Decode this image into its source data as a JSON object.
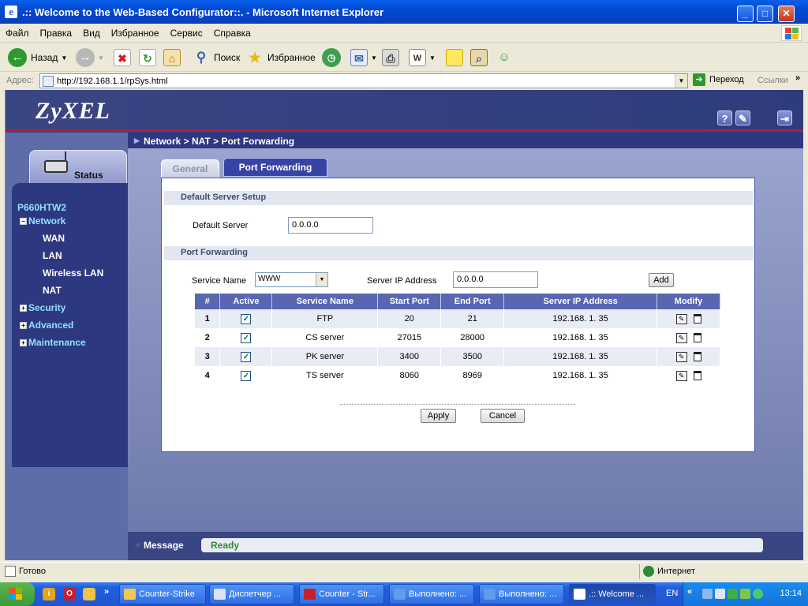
{
  "window": {
    "title": ".:: Welcome to the Web-Based Configurator::. - Microsoft Internet Explorer",
    "minimize": "_",
    "maximize": "□",
    "close": "✕"
  },
  "menubar": {
    "items": [
      "Файл",
      "Правка",
      "Вид",
      "Избранное",
      "Сервис",
      "Справка"
    ]
  },
  "toolbar": {
    "back_label": "Назад",
    "search_label": "Поиск",
    "favorites_label": "Избранное"
  },
  "addressbar": {
    "label": "Адрес:",
    "url": "http://192.168.1.1/rpSys.html",
    "go_label": "Переход",
    "links_label": "Ссылки"
  },
  "app": {
    "logo": "ZyXEL",
    "header_icons": [
      "help-icon",
      "wizard-icon",
      "logout-icon"
    ]
  },
  "breadcrumb": "Network > NAT > Port Forwarding",
  "sidebar": {
    "status_label": "Status",
    "device": "P660HTW2",
    "items": [
      {
        "label": "Network",
        "expand": "−"
      },
      {
        "label": "WAN"
      },
      {
        "label": "LAN"
      },
      {
        "label": "Wireless LAN"
      },
      {
        "label": "NAT"
      },
      {
        "label": "Security",
        "expand": "+"
      },
      {
        "label": "Advanced",
        "expand": "+"
      },
      {
        "label": "Maintenance",
        "expand": "+"
      }
    ]
  },
  "tabs": [
    {
      "label": "General"
    },
    {
      "label": "Port Forwarding"
    }
  ],
  "default_server": {
    "section_title": "Default Server Setup",
    "label": "Default Server",
    "value": "0.0.0.0"
  },
  "port_forwarding": {
    "section_title": "Port Forwarding",
    "service_name_label": "Service Name",
    "service_name_value": "WWW",
    "server_ip_label": "Server IP Address",
    "server_ip_value": "0.0.0.0",
    "add_label": "Add",
    "columns": [
      "#",
      "Active",
      "Service Name",
      "Start Port",
      "End Port",
      "Server IP Address",
      "Modify"
    ],
    "rows": [
      {
        "num": "1",
        "active": "✓",
        "name": "FTP",
        "start": "20",
        "end": "21",
        "ip": "192.168. 1. 35"
      },
      {
        "num": "2",
        "active": "✓",
        "name": "CS server",
        "start": "27015",
        "end": "28000",
        "ip": "192.168. 1. 35"
      },
      {
        "num": "3",
        "active": "✓",
        "name": "PK server",
        "start": "3400",
        "end": "3500",
        "ip": "192.168. 1. 35"
      },
      {
        "num": "4",
        "active": "✓",
        "name": "TS server",
        "start": "8060",
        "end": "8969",
        "ip": "192.168. 1. 35"
      }
    ]
  },
  "actions": {
    "apply_label": "Apply",
    "cancel_label": "Cancel"
  },
  "message": {
    "label": "Message",
    "text": "Ready"
  },
  "statusbar": {
    "text": "Готово",
    "zone": "Интернет"
  },
  "taskbar": {
    "buttons": [
      {
        "label": "Counter-Strike"
      },
      {
        "label": "Диспетчер ..."
      },
      {
        "label": "Counter - Str..."
      },
      {
        "label": "Выполнено: ..."
      },
      {
        "label": "Выполнено: ..."
      },
      {
        "label": ".:: Welcome ..."
      }
    ],
    "lang": "EN",
    "clock": "13:14"
  },
  "colors": {
    "brand_navy": "#2E3880",
    "accent_red": "#B01E3A",
    "ready_green": "#2E8B2E"
  }
}
